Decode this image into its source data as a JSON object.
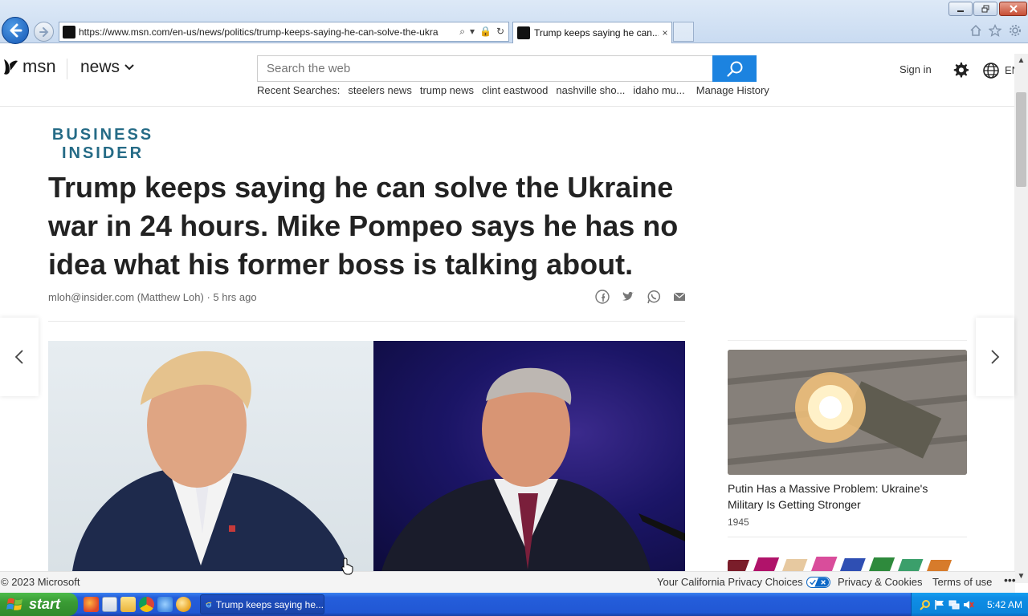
{
  "browser": {
    "url": "https://www.msn.com/en-us/news/politics/trump-keeps-saying-he-can-solve-the-ukra",
    "tab_title": "Trump keeps saying he can...",
    "tab_close": "×"
  },
  "header": {
    "logo_text": "msn",
    "section": "news",
    "search_placeholder": "Search the web",
    "recent_label": "Recent Searches:",
    "recent_searches": [
      "steelers news",
      "trump news",
      "clint eastwood",
      "nashville sho...",
      "idaho mu..."
    ],
    "manage_history": "Manage History",
    "sign_in": "Sign in",
    "language": "EN"
  },
  "article": {
    "publisher_line1": "BUSINESS",
    "publisher_line2": "INSIDER",
    "headline": "Trump keeps saying he can solve the Ukraine war in 24 hours. Mike Pompeo says he has no idea what his former boss is talking about.",
    "author": "mloh@insider.com (Matthew Loh)",
    "time_ago": "5 hrs ago",
    "share_icons": [
      "facebook-icon",
      "twitter-icon",
      "whatsapp-icon",
      "mail-icon"
    ]
  },
  "sidebar": {
    "card_title": "Putin Has a Massive Problem: Ukraine's Military Is Getting Stronger",
    "card_count": "1945"
  },
  "footer": {
    "copyright": "© 2023 Microsoft",
    "privacy_choices": "Your California Privacy Choices",
    "privacy_cookies": "Privacy & Cookies",
    "terms": "Terms of use",
    "more": "•••"
  },
  "taskbar": {
    "start_label": "start",
    "task_title": "Trump keeps saying he...",
    "clock": "5:42 AM"
  },
  "colors": {
    "accent": "#1c83e0",
    "publisher": "#256b86",
    "taskbar": "#245edb",
    "start": "#3a9b34"
  }
}
